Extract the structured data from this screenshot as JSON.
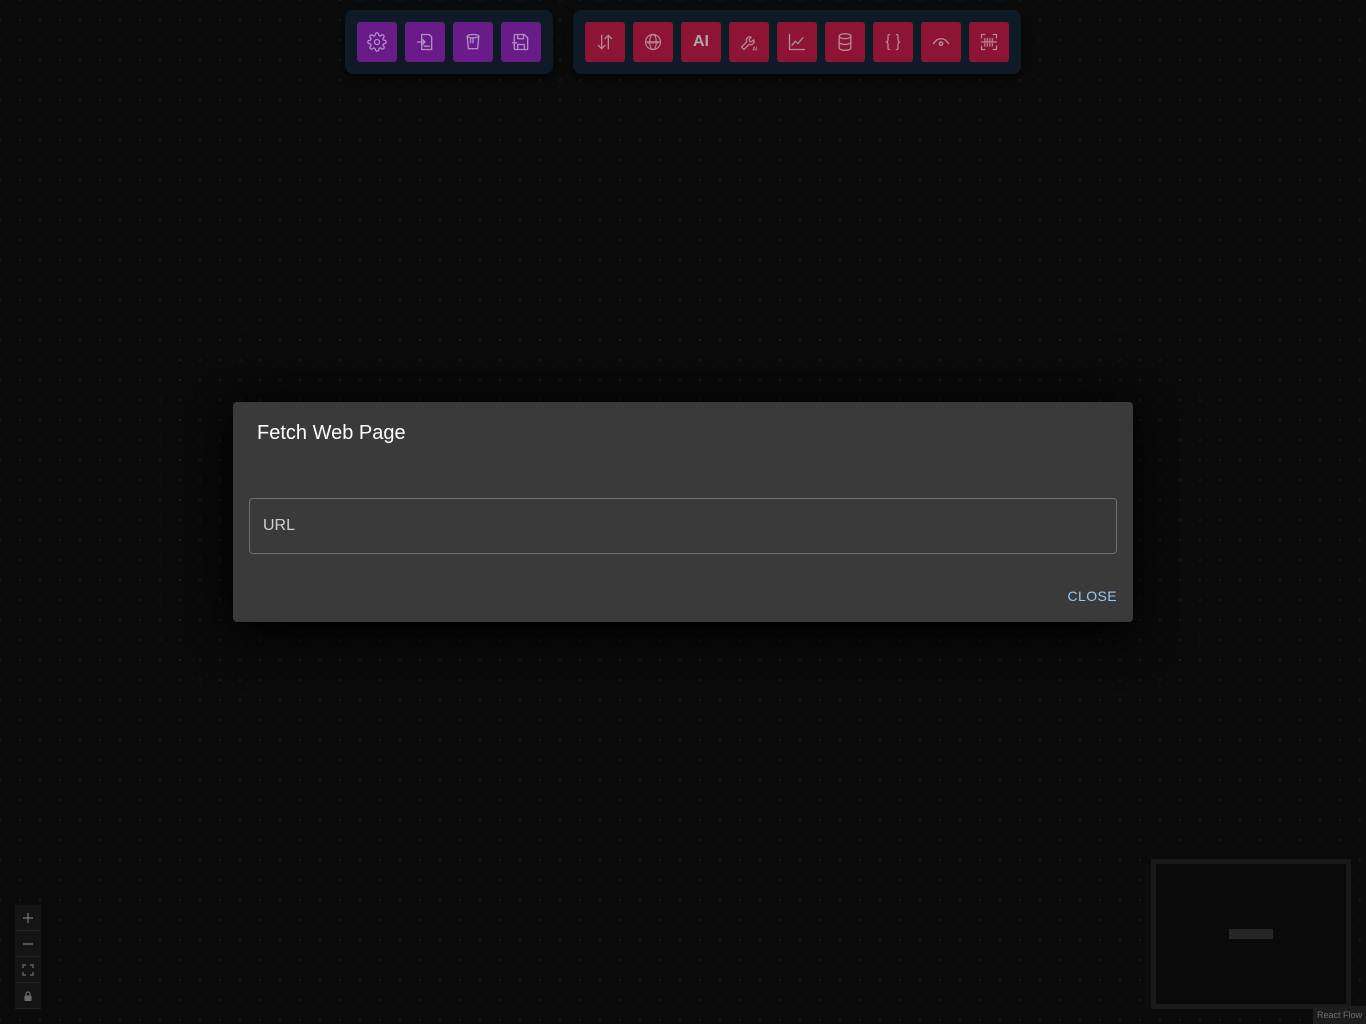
{
  "toolbar_left": {
    "buttons": [
      {
        "icon": "gear-icon"
      },
      {
        "icon": "import-icon"
      },
      {
        "icon": "clear-canvas-icon"
      },
      {
        "icon": "save-icon"
      }
    ]
  },
  "toolbar_right": {
    "buttons": [
      {
        "icon": "sort-arrows-icon"
      },
      {
        "icon": "www-globe-icon"
      },
      {
        "icon": "ai-text-icon",
        "label": "AI"
      },
      {
        "icon": "ai-tool-icon"
      },
      {
        "icon": "line-chart-icon"
      },
      {
        "icon": "database-icon"
      },
      {
        "icon": "braces-icon",
        "label": "{ }"
      },
      {
        "icon": "eye-icon"
      },
      {
        "icon": "scan-icon"
      }
    ]
  },
  "dialog": {
    "title": "Fetch Web Page",
    "url_placeholder": "URL",
    "url_value": "",
    "close_label": "CLOSE"
  },
  "flow_controls": {
    "buttons": [
      "zoom-in-icon",
      "zoom-out-icon",
      "fit-view-icon",
      "lock-icon"
    ]
  },
  "attribution": "React Flow",
  "colors": {
    "left_toolbar_button": "#6a1b8a",
    "right_toolbar_button": "#8e1434",
    "toolbar_bg": "#0e1a26",
    "dialog_bg": "#3a3a3a",
    "close_text": "#90caf9"
  }
}
